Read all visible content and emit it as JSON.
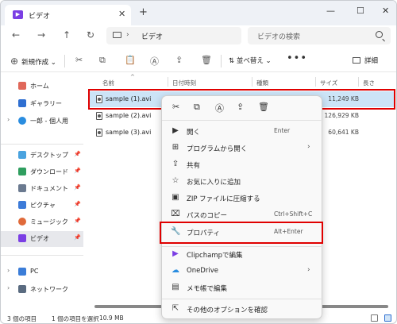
{
  "window": {
    "tab_title": "ビデオ",
    "new_tab": "+",
    "close_tab": "✕",
    "minimize": "—",
    "maximize": "☐",
    "close": "✕"
  },
  "nav": {
    "back": "←",
    "forward": "→",
    "up": "↑",
    "refresh": "↻",
    "address_sep": "›",
    "address": "ビデオ",
    "search_placeholder": "ビデオの検索"
  },
  "commandbar": {
    "new_label": "新規作成",
    "sort_label": "並べ替え",
    "more": "•••",
    "details_label": "詳細"
  },
  "sidebar": {
    "items": [
      {
        "label": "ホーム",
        "color": "#e0685a"
      },
      {
        "label": "ギャラリー",
        "color": "#2f6fd1"
      },
      {
        "label": "一郎 - 個人用",
        "color": "#2a8de0"
      },
      {
        "label": "デスクトップ",
        "color": "#4aa3df"
      },
      {
        "label": "ダウンロード",
        "color": "#2f9e5f"
      },
      {
        "label": "ドキュメント",
        "color": "#6b7a90"
      },
      {
        "label": "ピクチャ",
        "color": "#3d7bd8"
      },
      {
        "label": "ミュージック",
        "color": "#e06a3a"
      },
      {
        "label": "ビデオ",
        "color": "#7b3fe4"
      },
      {
        "label": "PC",
        "color": "#3b7dd8"
      },
      {
        "label": "ネットワーク",
        "color": "#5a6b80"
      }
    ]
  },
  "filelist": {
    "columns": [
      "名前",
      "日付時刻",
      "種類",
      "サイズ",
      "長さ"
    ],
    "sort_caret": "^",
    "rows": [
      {
        "name": "sample (1).avi",
        "size": "11,249 KB"
      },
      {
        "name": "sample (2).avi",
        "size": "126,929 KB"
      },
      {
        "name": "sample (3).avi",
        "size": "60,641 KB"
      }
    ]
  },
  "status": {
    "count": "3 個の項目",
    "selected": "1 個の項目を選択",
    "size": "10.9 MB"
  },
  "context_menu": {
    "items": [
      {
        "label": "開く",
        "shortcut": "Enter",
        "icon": "▶"
      },
      {
        "label": "プログラムから開く",
        "arrow": "›",
        "icon": "⊞"
      },
      {
        "label": "共有",
        "icon": "⇪"
      },
      {
        "label": "お気に入りに追加",
        "icon": "☆"
      },
      {
        "label": "ZIP ファイルに圧縮する",
        "icon": "▣"
      },
      {
        "label": "パスのコピー",
        "shortcut": "Ctrl+Shift+C",
        "icon": "⌧"
      },
      {
        "label": "プロパティ",
        "shortcut": "Alt+Enter",
        "icon": "🔧"
      },
      {
        "label": "Clipchampで編集",
        "icon": "▶"
      },
      {
        "label": "OneDrive",
        "arrow": "›",
        "icon": "☁"
      },
      {
        "label": "メモ帳で編集",
        "icon": "▤"
      },
      {
        "label": "その他のオプションを確認",
        "icon": "⇱"
      }
    ]
  }
}
